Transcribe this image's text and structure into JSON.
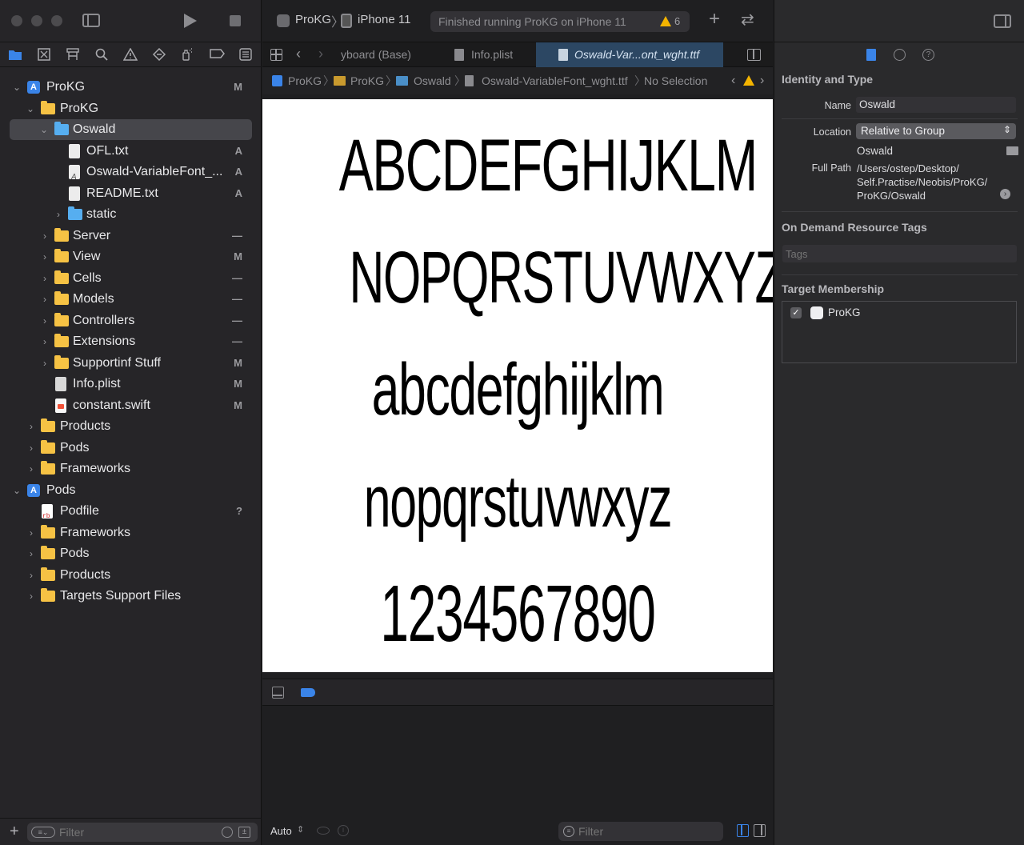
{
  "scheme": {
    "project": "ProKG",
    "device": "iPhone 11",
    "status": "Finished running ProKG on iPhone 11",
    "warnings": "6"
  },
  "tabs": [
    "yboard (Base)",
    "Info.plist",
    "Oswald-Var...ont_wght.ttf"
  ],
  "jumpbar": [
    "ProKG",
    "ProKG",
    "Oswald",
    "Oswald-VariableFont_wght.ttf",
    "No Selection"
  ],
  "tree": [
    {
      "label": "ProKG",
      "badge": "M"
    },
    {
      "label": "ProKG",
      "badge": ""
    },
    {
      "label": "Oswald",
      "badge": ""
    },
    {
      "label": "OFL.txt",
      "badge": "A"
    },
    {
      "label": "Oswald-VariableFont_...",
      "badge": "A"
    },
    {
      "label": "README.txt",
      "badge": "A"
    },
    {
      "label": "static",
      "badge": ""
    },
    {
      "label": "Server",
      "badge": "—"
    },
    {
      "label": "View",
      "badge": "M"
    },
    {
      "label": "Cells",
      "badge": "—"
    },
    {
      "label": "Models",
      "badge": "—"
    },
    {
      "label": "Controllers",
      "badge": "—"
    },
    {
      "label": "Extensions",
      "badge": "—"
    },
    {
      "label": "Supportinf Stuff",
      "badge": "M"
    },
    {
      "label": "Info.plist",
      "badge": "M"
    },
    {
      "label": "constant.swift",
      "badge": "M"
    },
    {
      "label": "Products",
      "badge": ""
    },
    {
      "label": "Pods",
      "badge": ""
    },
    {
      "label": "Frameworks",
      "badge": ""
    },
    {
      "label": "Pods",
      "badge": ""
    },
    {
      "label": "Podfile",
      "badge": "?"
    },
    {
      "label": "Frameworks",
      "badge": ""
    },
    {
      "label": "Pods",
      "badge": ""
    },
    {
      "label": "Products",
      "badge": ""
    },
    {
      "label": "Targets Support Files",
      "badge": ""
    }
  ],
  "navigator_filter": {
    "placeholder": "Filter"
  },
  "preview": {
    "lines": [
      "ABCDEFGHIJKLM",
      "NOPQRSTUVWXYZ",
      "abcdefghijklm",
      "nopqrstuvwxyz",
      "1234567890"
    ]
  },
  "editor_bottom": {
    "mode": "Auto",
    "filter_placeholder": "Filter"
  },
  "inspector": {
    "identity_title": "Identity and Type",
    "name_label": "Name",
    "name_value": "Oswald",
    "location_label": "Location",
    "location_value": "Relative to Group",
    "location_name": "Oswald",
    "fullpath_label": "Full Path",
    "fullpath_lines": [
      "/Users/ostep/Desktop/",
      "Self.Practise/Neobis/ProKG/",
      "ProKG/Oswald"
    ],
    "ondemand_title": "On Demand Resource Tags",
    "tags_placeholder": "Tags",
    "target_title": "Target Membership",
    "target_name": "ProKG"
  },
  "colors": {
    "accent": "#3a84e8",
    "folder": "#f6c244",
    "folder_blue": "#56aef0",
    "warning": "#f4b400"
  }
}
